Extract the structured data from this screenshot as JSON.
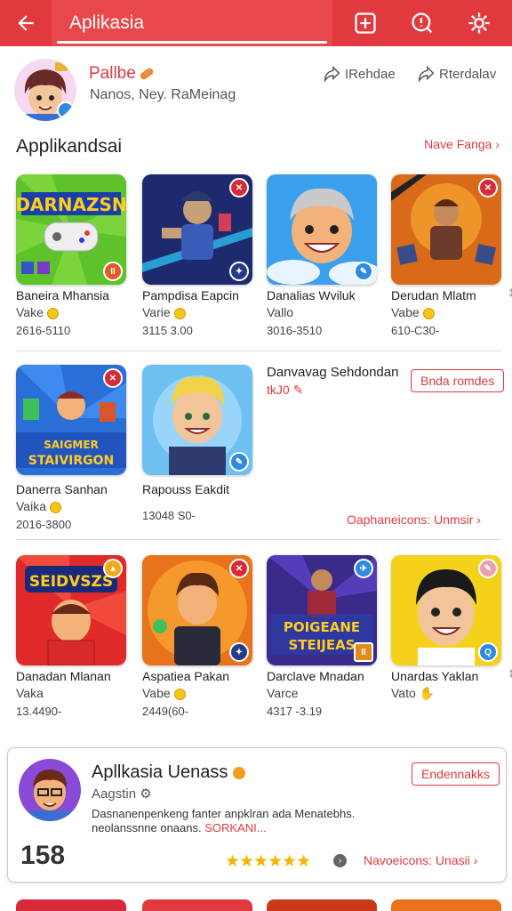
{
  "header": {
    "title": "Aplikasia",
    "colors": {
      "bar": "#e03a3e",
      "tab": "#e8484b"
    },
    "icons": [
      "back-arrow-icon",
      "add-box-icon",
      "info-icon",
      "settings-icon"
    ]
  },
  "profile": {
    "name": "Pallbe",
    "subtitle": "Nanos, Ney. RaMeinag",
    "actions": [
      {
        "label": "IRehdae",
        "icon": "share-icon"
      },
      {
        "label": "Rterdalav",
        "icon": "share-icon"
      }
    ]
  },
  "section": {
    "title": "Applikandsai",
    "link": "Nave Fanga ›"
  },
  "row1": [
    {
      "name": "Baneira Mhansia",
      "sub": "Vake",
      "meta": "2616-5110",
      "art": "DARNAZSN"
    },
    {
      "name": "Pampdisa Eapcin",
      "sub": "Varie",
      "meta": "3115  3.00"
    },
    {
      "name": "Danalias Wviluk",
      "sub": "Vallo",
      "meta": "3016-3510"
    },
    {
      "name": "Derudan Mlatm",
      "sub": "Vabe",
      "meta": "610-C30-"
    }
  ],
  "row2": [
    {
      "name": "Danerra Sanhan",
      "sub": "Vaika",
      "meta": "2016-3800",
      "art": "SAIGMER STAIVIRGON"
    },
    {
      "name": "Rapouss Eakdit",
      "sub": "",
      "meta": "13048 S0-"
    }
  ],
  "feature": {
    "title": "Danvavag Sehdondan",
    "price": "tkJ0",
    "button": "Bnda romdes",
    "link": "Oaphaneicons: Unmsir ›"
  },
  "row3": [
    {
      "name": "Danadan Mlanan",
      "sub": "Vaka",
      "meta": "13.4490-",
      "art": "SEIDVSZS"
    },
    {
      "name": "Aspatiea Pakan",
      "sub": "Vabe",
      "meta": "2449(60-"
    },
    {
      "name": "Darclave Mnadan",
      "sub": "Varce",
      "meta": "4317 -3.19",
      "art": "POIGEANE STEIJEAS"
    },
    {
      "name": "Unardas Yaklan",
      "sub": "Vato",
      "meta": ""
    }
  ],
  "promo": {
    "title": "Apllkasia Uenass",
    "subtitle": "Aagstin",
    "description": "Dasnanenpenkeng fanter anpklran ada Menatebhs. neolanssnne onaans.",
    "highlight": "SORKANI...",
    "count": "158",
    "button": "Endennakks",
    "stars": "★★★★★★",
    "link": "Navoeicons: Unasii ›"
  }
}
